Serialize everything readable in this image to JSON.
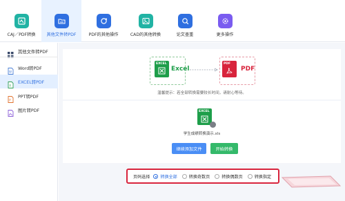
{
  "toolbar": {
    "items": [
      {
        "label": "CAJ／PDF转换",
        "icon": "caj-pdf-icon",
        "color": "#21b3a4"
      },
      {
        "label": "其他文件转PDF",
        "icon": "folder-icon",
        "color": "#2f6fe0"
      },
      {
        "label": "PDF的其他操作",
        "icon": "pdf-refresh-icon",
        "color": "#2f6fe0"
      },
      {
        "label": "CAD的其他转换",
        "icon": "image-icon",
        "color": "#21b3a4"
      },
      {
        "label": "论文查重",
        "icon": "magnifier-icon",
        "color": "#2f6fe0"
      },
      {
        "label": "更多操作",
        "icon": "gear-icon",
        "color": "#7a5cf0"
      }
    ],
    "active_index": 1
  },
  "sidebar": {
    "items": [
      {
        "label": "其他文件转PDF",
        "icon": "grid-icon"
      },
      {
        "label": "Word转PDF",
        "icon": "word-file-icon"
      },
      {
        "label": "EXCEL转PDF",
        "icon": "excel-file-icon"
      },
      {
        "label": "PPT转PDF",
        "icon": "ppt-file-icon"
      },
      {
        "label": "图片转PDF",
        "icon": "picture-file-icon"
      }
    ],
    "active_index": 2
  },
  "conversion": {
    "from_tag": "EXCEL",
    "from_name": "Excel",
    "to_tag": "PDF",
    "to_name": "PDF",
    "from_color": "#1e9e4a",
    "to_color": "#d8243c"
  },
  "tip": "温馨提示：若全部转换需要较长时间，请耐心等待。",
  "file": {
    "tag": "EXCEL",
    "name": "学生成绩转换演示.xls"
  },
  "buttons": {
    "add_label": "继续添加文件",
    "start_label": "开始转换",
    "add_color": "#4a8ef5",
    "start_color": "#34b96a"
  },
  "page_select": {
    "label": "页码选择",
    "options": [
      "转换全部",
      "转换奇数页",
      "转换偶数页",
      "转换指定"
    ],
    "selected_index": 0
  }
}
